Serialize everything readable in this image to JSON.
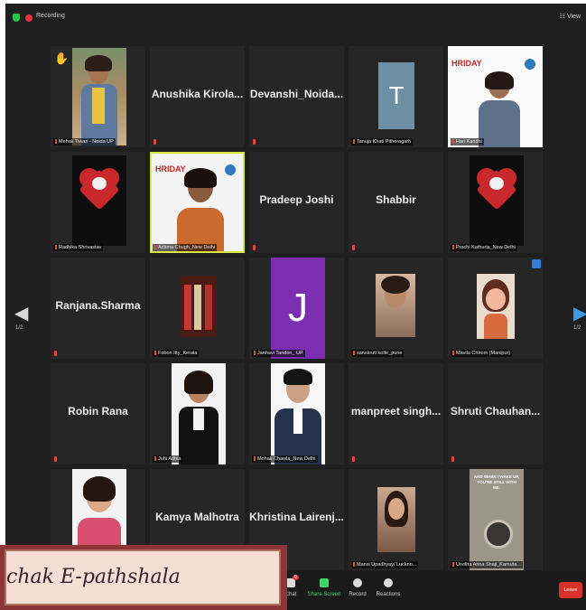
{
  "topbar": {
    "recording": "Recording",
    "view": "View"
  },
  "pager": {
    "left": "1/2",
    "right": "1/2"
  },
  "tiles": [
    {
      "label": "Mehak Tiwari - Noida UP"
    },
    {
      "name": "Anushika Kirola..."
    },
    {
      "name": "Devanshi_Noida..."
    },
    {
      "label": "Tanuja Khati Pithoragarh",
      "avatar_letter": "T"
    },
    {
      "label": "Hari Kandhi"
    },
    {
      "label": "Radhika Shrivastav"
    },
    {
      "label": "Aditma Chugh_New Delhi",
      "banner": "HRIDAY"
    },
    {
      "name": "Pradeep Joshi"
    },
    {
      "name": "Shabbir"
    },
    {
      "label": "Prachi Kathuria_New Delhi"
    },
    {
      "name": "Ranjana.Sharma"
    },
    {
      "label": "Fobon Itty_Kerala"
    },
    {
      "label": "Janhavi Tandon_ UP",
      "avatar_letter": "J"
    },
    {
      "label": "sanskruti kolte_pune"
    },
    {
      "label": "Mavila Chirom (Manipur)"
    },
    {
      "name": "Robin Rana"
    },
    {
      "label": "Juhi Adhia"
    },
    {
      "label": "Mohak Chawla_New Delhi"
    },
    {
      "name": "manpreet singh..."
    },
    {
      "name": "Shruti Chauhan..."
    },
    {
      "label": ""
    },
    {
      "name": "Kamya Malhotra"
    },
    {
      "name": "Khristina Lairenj..."
    },
    {
      "label": "Mansi Upadhyay/ Luckno..."
    },
    {
      "label": "Urvitha Anna Shaji_Kamuta..."
    }
  ],
  "hriday_banner": "HRIDAY",
  "quote_text": "AND WHEN I WAKE UP, YOU'RE STILL WITH ME.",
  "toolbar": {
    "chat": "Chat",
    "chat_badge": "9",
    "share": "Share Screen",
    "record": "Record",
    "reactions": "Reactions",
    "leave": "Leave"
  },
  "watermark": "chak E-pathshala",
  "colors": {
    "active_outline": "#d7e83e",
    "share_green": "#3fd36a",
    "leave_red": "#d6322b",
    "watermark_frame": "#8b3538"
  }
}
